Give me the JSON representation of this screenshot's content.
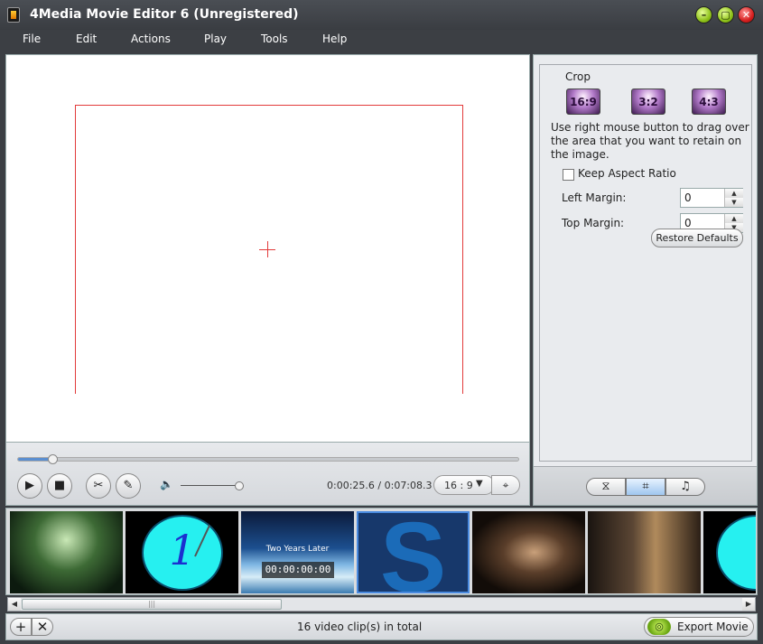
{
  "window": {
    "title": "4Media Movie Editor 6 (Unregistered)",
    "minimize_glyph": "–",
    "maximize_glyph": "▢",
    "close_glyph": "✕"
  },
  "menu": {
    "items": [
      "File",
      "Edit",
      "Actions",
      "Play",
      "Tools",
      "Help"
    ]
  },
  "player": {
    "progress_fraction": 0.069,
    "volume_fraction": 0.98,
    "time_current": "0:00:25.6",
    "time_separator": " / ",
    "time_total": "0:07:08.3",
    "aspect_ratio": "16 : 9",
    "play_glyph": "▶",
    "stop_glyph": "■",
    "cut_glyph": "✂",
    "edit_glyph": "✎",
    "volume_glyph": "🔈",
    "chevron_glyph": "▼",
    "fit_glyph": "⌖"
  },
  "crop_panel": {
    "title": "Crop",
    "ratio_buttons": [
      "16:9",
      "3:2",
      "4:3"
    ],
    "help_text": "Use right mouse button to drag over the area that you want to retain on the image.",
    "keep_aspect_label": "Keep Aspect Ratio",
    "keep_aspect_checked": false,
    "left_margin_label": "Left Margin:",
    "left_margin_value": "0",
    "top_margin_label": "Top Margin:",
    "top_margin_value": "0",
    "restore_label": "Restore Defaults",
    "spin_up": "▲",
    "spin_down": "▼"
  },
  "mode_tabs": {
    "effects_glyph": "⧖",
    "crop_glyph": "⌗",
    "audio_glyph": "♫",
    "active": "crop"
  },
  "timeline": {
    "clip2_number": "1",
    "clip3_caption": "Two Years Later",
    "clip3_timecode": "00:00:00:00",
    "clip4_letter": "S",
    "scroll_left": "◀",
    "scroll_right": "▶",
    "scroll_grip": "|||"
  },
  "footer": {
    "add_glyph": "+",
    "remove_glyph": "✕",
    "clip_count": "16 video clip(s) in total",
    "export_label": "Export Movie",
    "export_glyph": "◎"
  },
  "colors": {
    "crop_frame": "#e23b3b",
    "progress_fill": "#5a8ed0"
  }
}
